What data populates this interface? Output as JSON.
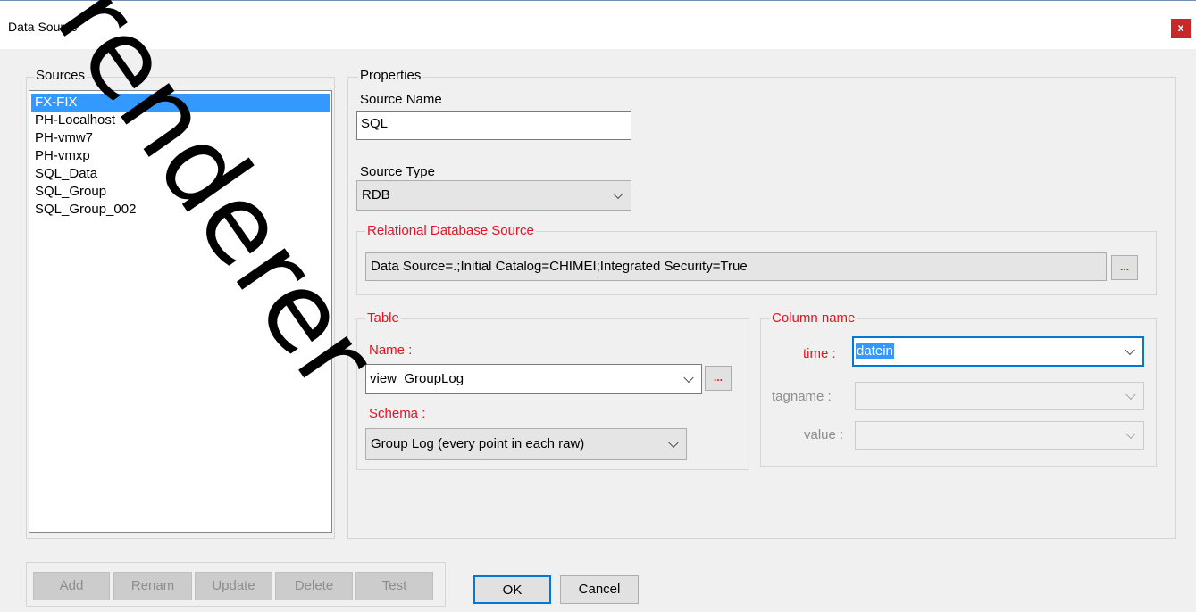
{
  "window": {
    "title": "Data Source",
    "close_label": "x"
  },
  "sources": {
    "legend": "Sources",
    "items": [
      "FX-FIX",
      "PH-Localhost",
      "PH-vmw7",
      "PH-vmxp",
      "SQL_Data",
      "SQL_Group",
      "SQL_Group_002"
    ],
    "selected_index": 0
  },
  "properties": {
    "legend": "Properties",
    "source_name_label": "Source Name",
    "source_name_value": "SQL",
    "source_type_label": "Source Type",
    "source_type_value": "RDB",
    "rdb": {
      "legend": "Relational Database Source",
      "connection_string": "Data Source=.;Initial Catalog=CHIMEI;Integrated Security=True",
      "browse_label": "..."
    },
    "table": {
      "legend": "Table",
      "name_label": "Name :",
      "name_value": "view_GroupLog",
      "browse_label": "...",
      "schema_label": "Schema :",
      "schema_value": "Group Log  (every point in each raw)"
    },
    "column": {
      "legend": "Column name",
      "time_label": "time :",
      "time_value": "datein",
      "tagname_label": "tagname :",
      "value_label": "value :"
    }
  },
  "buttons": {
    "add": "Add",
    "rename": "Renam",
    "update": "Update",
    "delete": "Delete",
    "test": "Test",
    "ok": "OK",
    "cancel": "Cancel"
  },
  "watermark": "renderer",
  "colors": {
    "accent_red": "#e81123",
    "selection": "#3399ff",
    "close": "#c8282a"
  }
}
